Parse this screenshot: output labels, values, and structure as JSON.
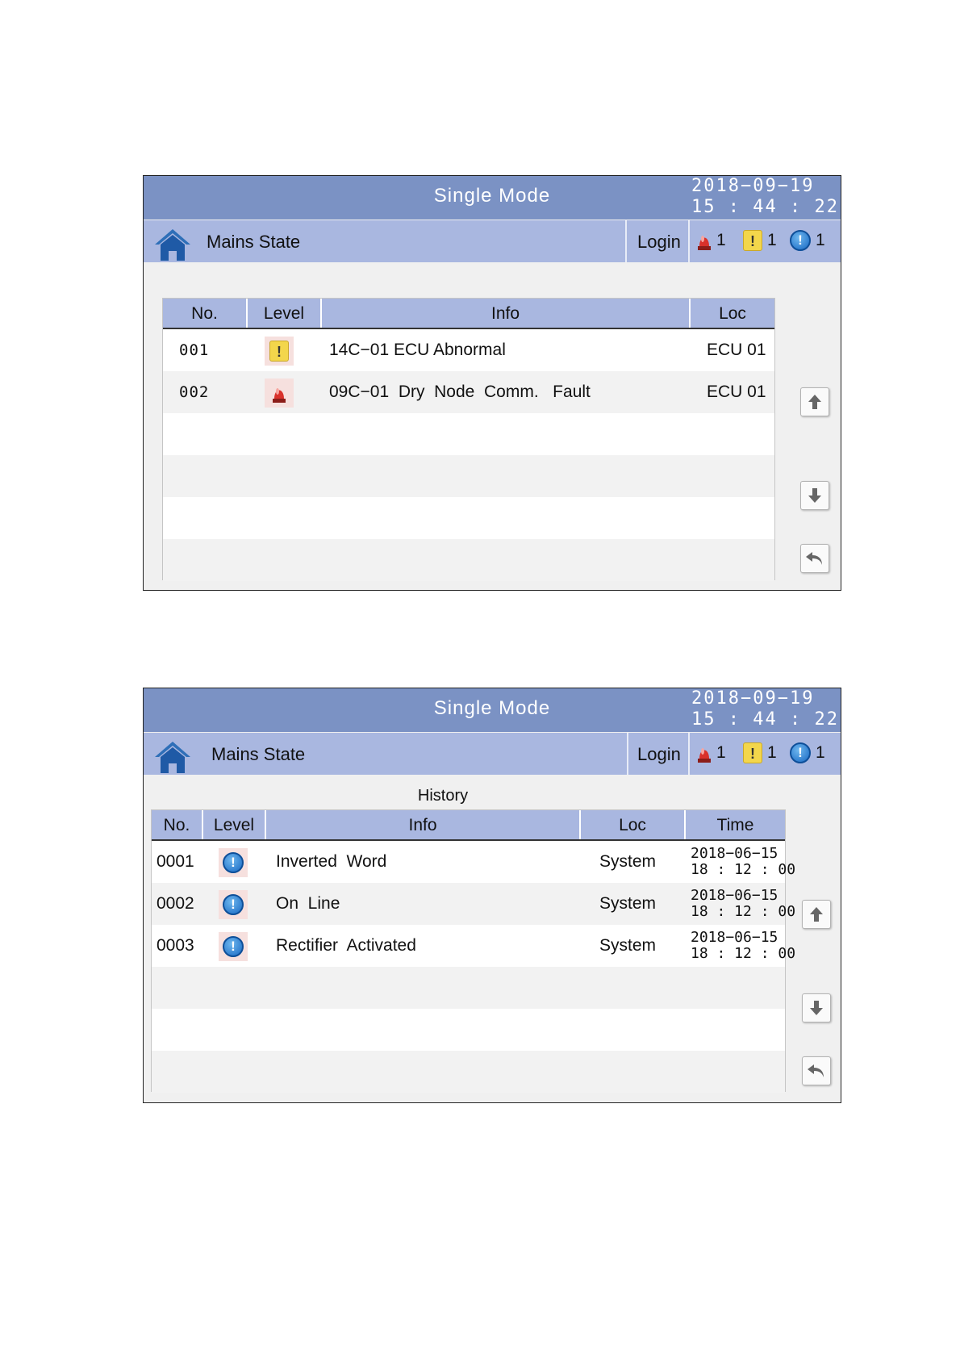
{
  "screens": [
    {
      "title": "Single Mode",
      "date": "2018−09−19",
      "time": "15 : 44 : 22",
      "state_label": "Mains State",
      "login_label": "Login",
      "counts": {
        "alarm": "1",
        "warning": "1",
        "info": "1"
      },
      "columns": [
        "No.",
        "Level",
        "Info",
        "Loc"
      ],
      "rows": [
        {
          "no": "001",
          "level": "warning",
          "info": "14C−01 ECU Abnormal",
          "loc": "ECU 01"
        },
        {
          "no": "002",
          "level": "alarm",
          "info": "09C−01  Dry  Node  Comm.   Fault",
          "loc": "ECU 01"
        }
      ]
    },
    {
      "title": "Single Mode",
      "date": "2018−09−19",
      "time": "15 : 44 : 22",
      "state_label": "Mains State",
      "login_label": "Login",
      "counts": {
        "alarm": "1",
        "warning": "1",
        "info": "1"
      },
      "section_title": "History",
      "columns": [
        "No.",
        "Level",
        "Info",
        "Loc",
        "Time"
      ],
      "rows": [
        {
          "no": "0001",
          "level": "info",
          "info": "Inverted  Word",
          "loc": "System",
          "date": "2018−06−15",
          "time": "18 : 12 : 00"
        },
        {
          "no": "0002",
          "level": "info",
          "info": "On  Line",
          "loc": "System",
          "date": "2018−06−15",
          "time": "18 : 12 : 00"
        },
        {
          "no": "0003",
          "level": "info",
          "info": "Rectifier  Activated",
          "loc": "System",
          "date": "2018−06−15",
          "time": "18 : 12 : 00"
        }
      ]
    }
  ],
  "icons": {
    "home": "home-icon",
    "alarm": "alarm-beacon-icon",
    "warning": "warning-icon",
    "info": "info-icon",
    "up": "arrow-up-icon",
    "down": "arrow-down-icon",
    "back": "return-icon"
  },
  "colors": {
    "title_bar": "#7b92c4",
    "state_bar": "#a9b7e0",
    "warning": "#f3d64b",
    "alarm": "#d9312b",
    "info": "#1768c3"
  }
}
